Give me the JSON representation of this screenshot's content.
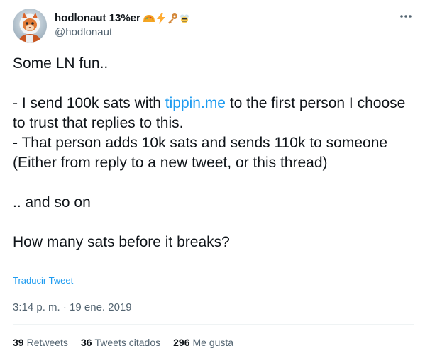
{
  "author": {
    "display_name": "hodlonaut 13%er",
    "handle": "@hodlonaut",
    "name_emojis": [
      "taco-icon",
      "lightning-icon",
      "key-icon",
      "bee-icon"
    ]
  },
  "tweet": {
    "intro": "Some LN fun..",
    "line1_prefix": "- I send 100k sats with ",
    "link_text": "tippin.me",
    "line1_suffix": " to the first person I choose to trust that replies to this.",
    "line2": "- That person adds 10k sats and sends 110k to someone (Either from reply to a new tweet, or this thread)",
    "line3": ".. and so on",
    "question": "How many sats before it breaks?"
  },
  "translate_label": "Traducir Tweet",
  "timestamp": "3:14 p. m. · 19 ene. 2019",
  "stats": {
    "retweets_count": "39",
    "retweets_label": "Retweets",
    "quotes_count": "36",
    "quotes_label": "Tweets citados",
    "likes_count": "296",
    "likes_label": "Me gusta"
  },
  "colors": {
    "link": "#1d9bf0",
    "text": "#0f1419",
    "secondary": "#536471"
  }
}
